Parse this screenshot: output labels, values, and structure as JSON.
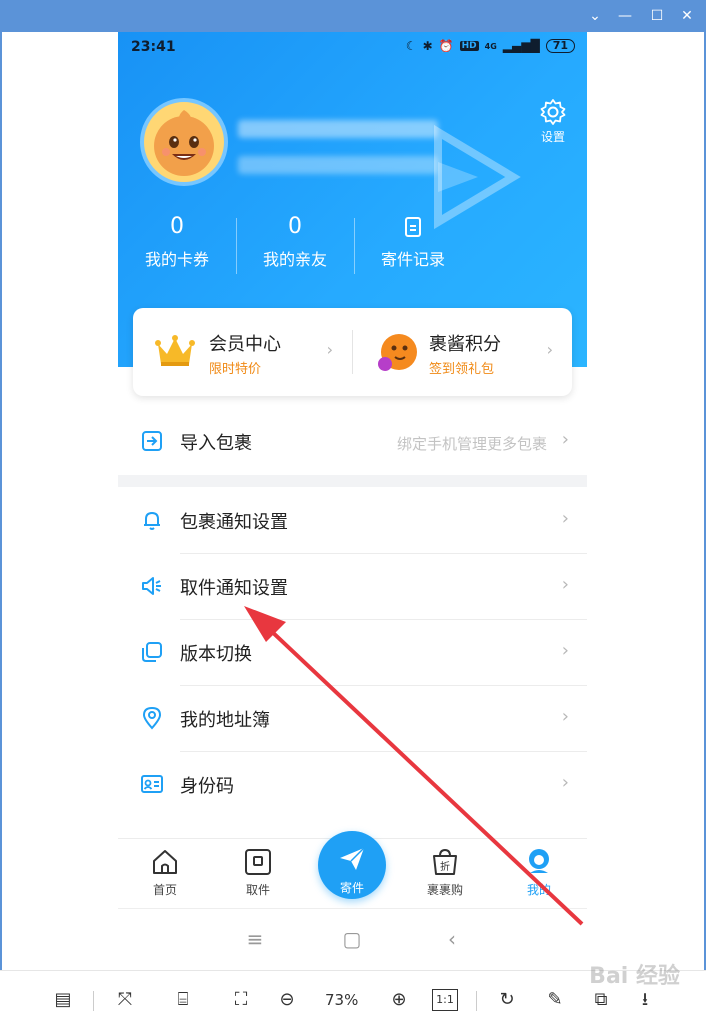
{
  "status": {
    "time": "23:41",
    "battery": "71",
    "hd": "HD",
    "net": "4G"
  },
  "profile": {
    "settings_label": "设置"
  },
  "stats": [
    {
      "value": "0",
      "label": "我的卡券"
    },
    {
      "value": "0",
      "label": "我的亲友"
    },
    {
      "value": "",
      "label": "寄件记录"
    }
  ],
  "member": {
    "left": {
      "title": "会员中心",
      "subtitle": "限时特价"
    },
    "right": {
      "title": "裹酱积分",
      "subtitle": "签到领礼包"
    }
  },
  "import_row": {
    "label": "导入包裹",
    "hint": "绑定手机管理更多包裹"
  },
  "menu": [
    {
      "label": "包裹通知设置",
      "icon": "bell-icon"
    },
    {
      "label": "取件通知设置",
      "icon": "speaker-icon"
    },
    {
      "label": "版本切换",
      "icon": "switch-icon"
    },
    {
      "label": "我的地址簿",
      "icon": "location-pin-icon"
    },
    {
      "label": "身份码",
      "icon": "id-card-icon"
    }
  ],
  "tabs": [
    {
      "label": "首页",
      "icon": "home-icon"
    },
    {
      "label": "取件",
      "icon": "pickup-icon"
    },
    {
      "label": "寄件",
      "icon": "send-icon"
    },
    {
      "label": "裹裹购",
      "icon": "shopping-bag-icon"
    },
    {
      "label": "我的",
      "icon": "profile-icon"
    }
  ],
  "toolbar": {
    "zoom": "73%",
    "ratio": "1:1"
  },
  "watermark": "Bai 经验",
  "colors": {
    "primary": "#1fa0f5",
    "accent_orange": "#f08a16",
    "annotation_red": "#e8373f"
  }
}
